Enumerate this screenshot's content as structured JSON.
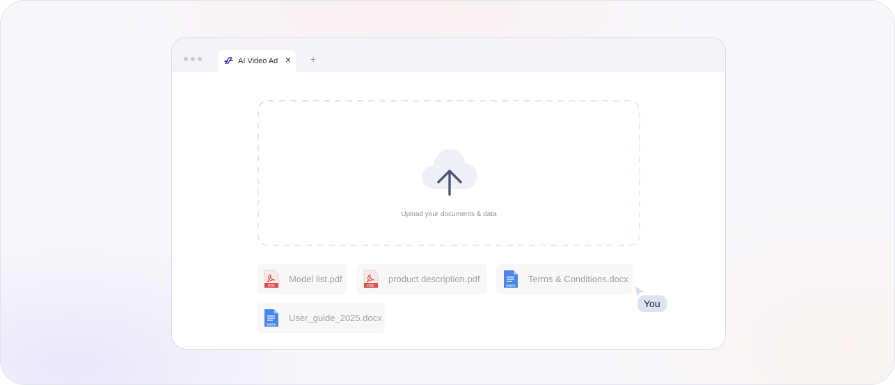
{
  "browser": {
    "tab": {
      "label": "AI Video Ad",
      "close_glyph": "✕",
      "icon": "brand-logo-icon"
    },
    "new_tab_glyph": "+"
  },
  "upload": {
    "prompt": "Upload your documents & data",
    "icon": "cloud-upload-icon"
  },
  "cursor": {
    "label": "You"
  },
  "files": [
    {
      "name": "Model list.pdf",
      "type": "pdf",
      "icon_label": "PDF"
    },
    {
      "name": "product description.pdf",
      "type": "pdf",
      "icon_label": "PDF"
    },
    {
      "name": "Terms & Conditions.docx",
      "type": "docx",
      "icon_label": "DOCX"
    },
    {
      "name": "User_guide_2025.docx",
      "type": "docx",
      "icon_label": "DOCX"
    }
  ],
  "colors": {
    "pdf_red": "#d9534f",
    "docx_blue": "#4a86e8",
    "accent": "#4a5578",
    "badge_bg": "#dde3f3"
  }
}
